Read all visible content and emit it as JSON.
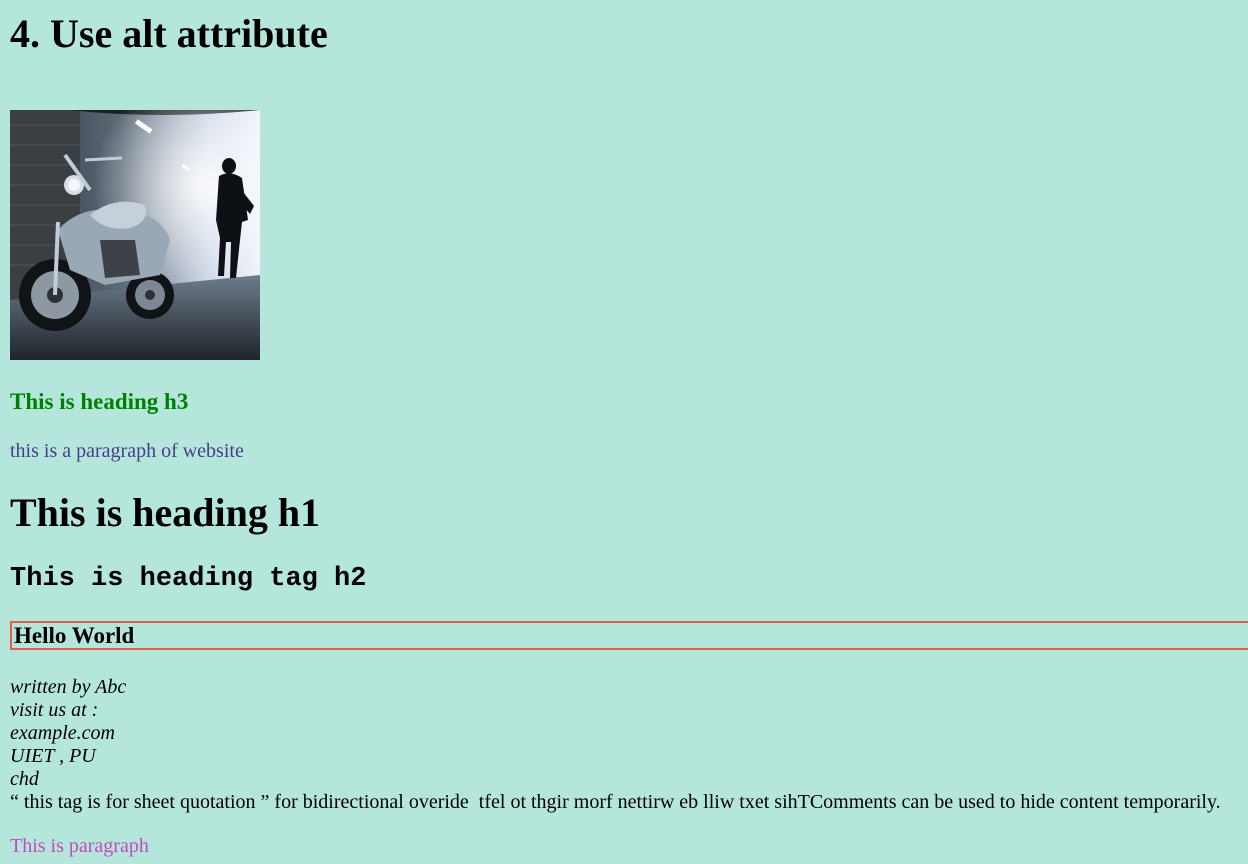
{
  "page": {
    "title": "4. Use alt attribute",
    "image_alt": "motorcycle in a misty tunnel with a walking figure",
    "heading_h3": "This is heading h3",
    "paragraph_1": "this is a paragraph of website",
    "heading_h1": "This is heading h1",
    "heading_h2": "This is heading tag h2",
    "boxed_heading": "Hello World",
    "address_lines": [
      "written by Abc",
      "visit us at :",
      "example.com",
      "UIET , PU",
      "chd"
    ],
    "quote_text": "this tag is for sheet quotation",
    "bidi_label": " for bidirectional overide  ",
    "bidi_text": "This text will be written from right to left",
    "comments_text": "Comments can be used to hide content temporarily.",
    "paragraph_2": "This is paragraph"
  },
  "colors": {
    "background": "#b5e6db",
    "h3": "#008000",
    "paragraph_1": "#483d8b",
    "boxed_border": "#e2604a",
    "paragraph_2": "#c04dc0"
  }
}
